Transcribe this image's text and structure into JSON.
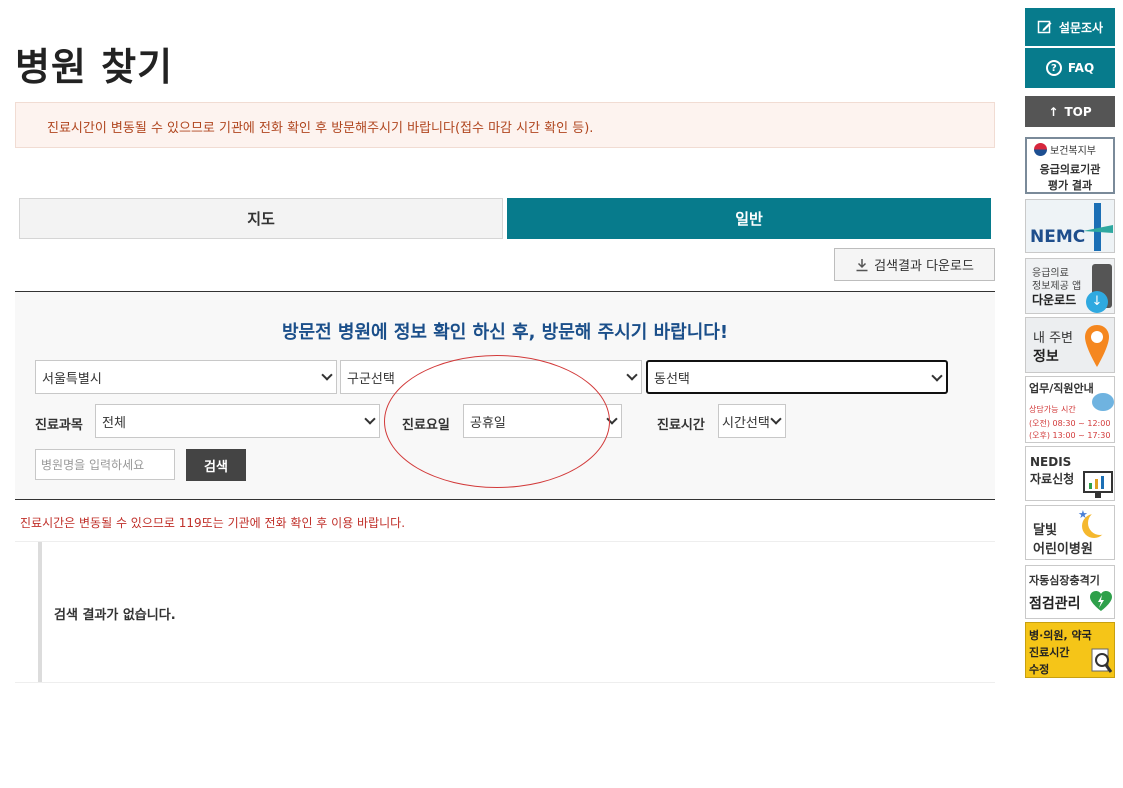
{
  "page_title": "병원 찾기",
  "notice": "진료시간이 변동될 수 있으므로 기관에 전화 확인 후 방문해주시기 바랍니다(접수 마감 시간 확인 등).",
  "tabs": [
    {
      "label": "지도"
    },
    {
      "label": "일반"
    }
  ],
  "download_label": "검색결과 다운로드",
  "search": {
    "heading": "방문전 병원에 정보 확인 하신 후, 방문해 주시기 바랍니다!",
    "sido": "서울특별시",
    "sigungu": "구군선택",
    "dong": "동선택",
    "dept_label": "진료과목",
    "dept_value": "전체",
    "day_label": "진료요일",
    "day_value": "공휴일",
    "time_label": "진료시간",
    "time_value": "시간선택",
    "name_placeholder": "병원명을 입력하세요",
    "button": "검색"
  },
  "warning": "진료시간은 변동될 수 있으므로 119또는 기관에 전화 확인 후 이용 바랍니다.",
  "result_empty": "검색 결과가 없습니다.",
  "sidebar": {
    "survey": "설문조사",
    "faq": "FAQ",
    "top": "TOP",
    "mohw_org": "보건복지부",
    "mohw_title": "응급의료기관",
    "mohw_sub": "평가 결과",
    "nemc": "NEMC",
    "app_line1": "응급의료",
    "app_line2": "정보제공 앱",
    "app_line3": "다운로드",
    "nearby_line1": "내 주변",
    "nearby_line2": "정보",
    "staff_title": "업무/직원안내",
    "staff_line1": "상담가능 시간",
    "staff_line2": "(오전) 08:30 ~ 12:00",
    "staff_line3": "(오후) 13:00 ~ 17:30",
    "nedis_line1": "NEDIS",
    "nedis_line2": "자료신청",
    "moon_line1": "달빛",
    "moon_line2": "어린이병원",
    "aed_line1": "자동심장충격기",
    "aed_line2": "점검관리",
    "hours_line1": "병·의원, 약국",
    "hours_line2": "진료시간",
    "hours_line3": "수정"
  },
  "colors": {
    "teal": "#077b8c",
    "notice_bg": "#fdf3ef",
    "warning": "#c0302a",
    "heading_blue": "#1b4f8a"
  }
}
